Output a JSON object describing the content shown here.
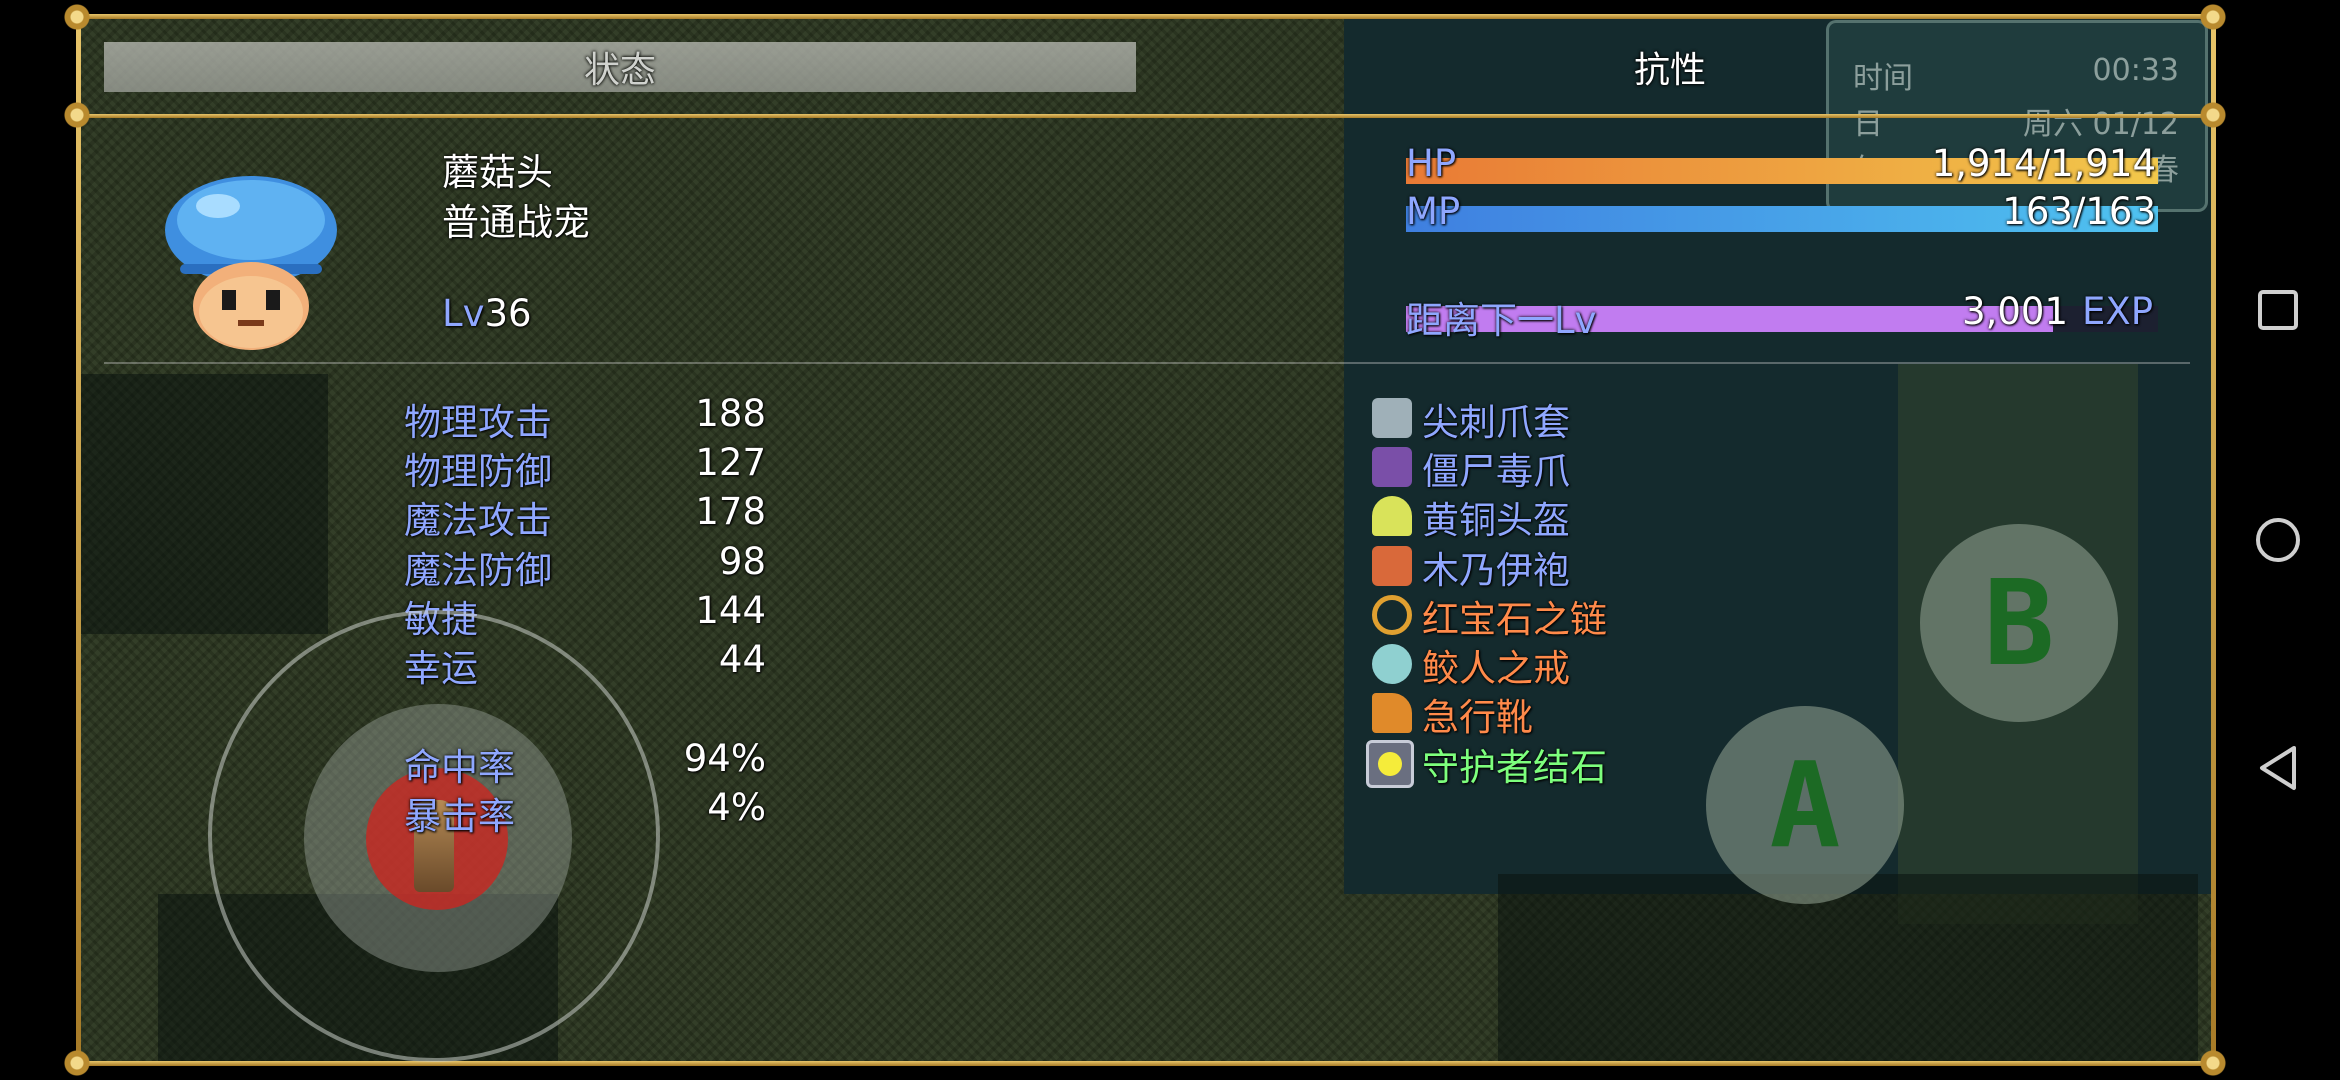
{
  "tabs": {
    "status": "状态",
    "resistance": "抗性"
  },
  "time_window": {
    "time_label": "时间",
    "time_value": "00:33",
    "day_label": "日",
    "day_value": "周六 01/12",
    "year_label": "年",
    "year_value": "春"
  },
  "character": {
    "name": "蘑菇头",
    "class": "普通战宠",
    "level_label": "Lv",
    "level": "36"
  },
  "gauges": {
    "hp": {
      "label": "HP",
      "value": "1,914/1,914",
      "fraction": 1.0,
      "color_start": "#e97a35",
      "color_end": "#f2c84b"
    },
    "mp": {
      "label": "MP",
      "value": "163/163",
      "fraction": 1.0,
      "color_start": "#3f7fe0",
      "color_end": "#4fc3f0"
    },
    "exp": {
      "label": "距离下一Lv",
      "value": "3,001",
      "unit": "EXP",
      "fraction": 0.86,
      "color": "#c17cf0"
    }
  },
  "stats": [
    {
      "label": "物理攻击",
      "value": "188"
    },
    {
      "label": "物理防御",
      "value": "127"
    },
    {
      "label": "魔法攻击",
      "value": "178"
    },
    {
      "label": "魔法防御",
      "value": "98"
    },
    {
      "label": "敏捷",
      "value": "144"
    },
    {
      "label": "幸运",
      "value": "44"
    }
  ],
  "rates": [
    {
      "label": "命中率",
      "value": "94%"
    },
    {
      "label": "暴击率",
      "value": "4%"
    }
  ],
  "equipment": [
    {
      "name": "尖刺爪套",
      "icon": "claw-glove-icon",
      "color": "#8fa7ff"
    },
    {
      "name": "僵尸毒爪",
      "icon": "zombie-claw-icon",
      "color": "#8fa7ff"
    },
    {
      "name": "黄铜头盔",
      "icon": "brass-helmet-icon",
      "color": "#8fa7ff"
    },
    {
      "name": "木乃伊袍",
      "icon": "mummy-robe-icon",
      "color": "#8fa7ff"
    },
    {
      "name": "红宝石之链",
      "icon": "ruby-chain-icon",
      "color": "#ff8a4a"
    },
    {
      "name": "鲛人之戒",
      "icon": "merfolk-ring-icon",
      "color": "#ff8a4a"
    },
    {
      "name": "急行靴",
      "icon": "swift-boots-icon",
      "color": "#ff8a4a"
    },
    {
      "name": "守护者结石",
      "icon": "guardian-stone-icon",
      "color": "#7dff7d"
    }
  ],
  "controls": {
    "a_label": "A",
    "b_label": "B"
  },
  "colors": {
    "system_text": "#8fa7ff",
    "frame_gold": "#d9b25a"
  }
}
